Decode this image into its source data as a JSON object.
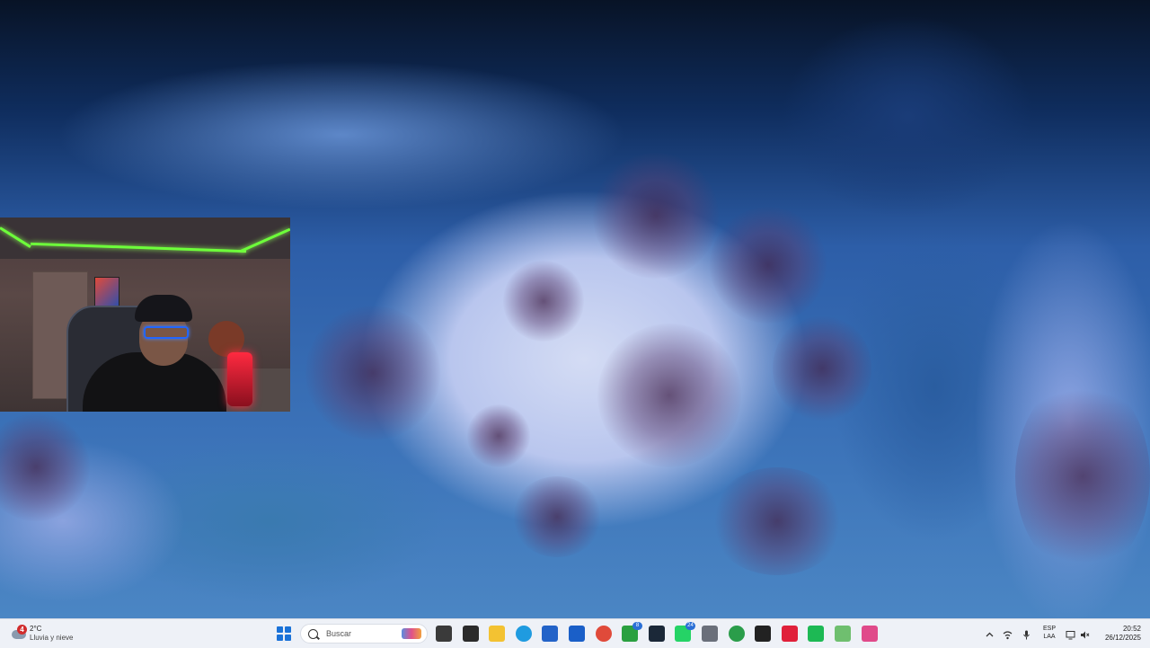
{
  "wallpaper": {
    "description_colors": {
      "ice": "#b9c6ee",
      "water": "#0f2d5e"
    }
  },
  "webcam": {
    "accent_led": "#6dff3a",
    "mic_color": "#ff2a40"
  },
  "taskbar": {
    "weather": {
      "badge": "4",
      "temperature": "2°C",
      "condition": "Lluvia y nieve"
    },
    "search": {
      "placeholder": "Buscar"
    },
    "pinned_apps": [
      {
        "name": "task-view-icon",
        "color": "#3a3a3a"
      },
      {
        "name": "app-icon-1",
        "color": "#2b2b2b"
      },
      {
        "name": "file-explorer-icon",
        "color": "#f3c232"
      },
      {
        "name": "edge-icon",
        "color": "#1f9be0"
      },
      {
        "name": "microsoft-store-icon",
        "color": "#2363c8"
      },
      {
        "name": "outlook-icon",
        "color": "#1a5fc8"
      },
      {
        "name": "chrome-icon",
        "color": "#e04a3a",
        "badge": ""
      },
      {
        "name": "xbox-icon",
        "color": "#2aa040",
        "badge": "8"
      },
      {
        "name": "steam-icon",
        "color": "#1b2838"
      },
      {
        "name": "whatsapp-icon",
        "color": "#25d366",
        "badge": "24"
      },
      {
        "name": "camera-icon",
        "color": "#6a6f7a"
      },
      {
        "name": "chrome-profile-icon",
        "color": "#2a9d4a"
      },
      {
        "name": "app-icon-2",
        "color": "#222222"
      },
      {
        "name": "tiktok-icon",
        "color": "#e0203a"
      },
      {
        "name": "spotify-icon",
        "color": "#1db954"
      },
      {
        "name": "notepad-icon",
        "color": "#6fbf6f"
      },
      {
        "name": "app-icon-3",
        "color": "#e04a8a"
      }
    ],
    "tray": {
      "language": "ESP",
      "layout": "LAA",
      "time": "20:52",
      "date": "26/12/2025"
    }
  }
}
